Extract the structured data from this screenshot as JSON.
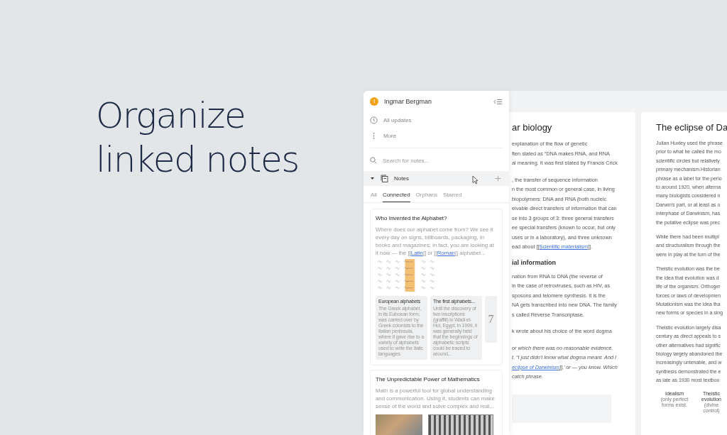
{
  "headline": [
    "Organize",
    "linked notes"
  ],
  "sidebar": {
    "user": {
      "initial": "I",
      "name": "Ingmar Bergman"
    },
    "nav": [
      {
        "kind": "clock",
        "label": "All updates"
      },
      {
        "kind": "dots",
        "label": "More"
      }
    ],
    "search": {
      "placeholder": "Search for notes..."
    },
    "section": {
      "label": "Notes",
      "expanded": true
    },
    "tabs": [
      {
        "label": "All",
        "selected": false
      },
      {
        "label": "Connected",
        "selected": true
      },
      {
        "label": "Orphans",
        "selected": false
      },
      {
        "label": "Starred",
        "selected": false
      }
    ],
    "notes": [
      {
        "kind": "alphabet",
        "title": "Who Invented the Alphabet?",
        "excerpt": [
          {
            "text": "Where does our alphabet come from? We see it every day on signs, billboards, packaging, in books and magazines; in fact, you are looking at it now — the [["
          },
          {
            "link": "Latin"
          },
          {
            "text": "]] or [["
          },
          {
            "link": "Roman"
          },
          {
            "text": "]] alphabet..."
          }
        ],
        "related": [
          {
            "title": "European alphabets",
            "text": "The Greek alphabet, in its Euboean form, was carried over by Greek colonists to the Italian peninsula, where it gave rise to a variety of alphabets used to write the Italic languages."
          },
          {
            "title": "The first alphabets...",
            "text": "Until the discovery of two inscriptions (graffiti) in Wadi el-Hol, Egypt, in 1999, it was generally held that the beginnings of alphabetic scripts could be traced to around..."
          }
        ],
        "more_count": "7"
      },
      {
        "kind": "images",
        "title": "The Unpredictable Power of Mathematics",
        "excerpt": [
          {
            "text": "Math is a powerful tool for global understanding and communication. Using it, students can make sense of the world and solve complex and real..."
          }
        ]
      }
    ]
  },
  "documents": [
    {
      "title": "ar biology",
      "blocks": [
        {
          "kind": "para",
          "lines": [
            [
              {
                "text": "explanation of the flow of genetic"
              }
            ],
            [
              {
                "text": "ften stated as “DNA makes RNA, and RNA"
              }
            ],
            [
              {
                "text": "al meaning. It was first stated by Francis Crick"
              }
            ]
          ]
        },
        {
          "kind": "para",
          "lines": [
            [
              {
                "text": ", the transfer of sequence information"
              }
            ],
            [
              {
                "text": "n the most common or general case, in living"
              }
            ],
            [
              {
                "text": "biopolymers: DNA and RNA (both nucleic"
              }
            ],
            [
              {
                "text": "eivable direct transfers of information that can"
              }
            ],
            [
              {
                "text": "se into 3 groups of 3: three general transfers"
              }
            ],
            [
              {
                "text": "ee special transfers (known to occur, but only"
              }
            ],
            [
              {
                "text": "uses or in a laboratory), and three unknown"
              }
            ],
            [
              {
                "text": "ead about [["
              },
              {
                "link": "Scientific materialism"
              },
              {
                "text": "]]."
              }
            ]
          ]
        },
        {
          "kind": "heading",
          "text": "ial information"
        },
        {
          "kind": "para",
          "lines": [
            [
              {
                "text": "nation from RNA to DNA (the reverse of"
              }
            ],
            [
              {
                "text": "in the case of retroviruses, such as HIV, as"
              }
            ],
            [
              {
                "text": "sposons and telomere synthesis. It is the"
              }
            ],
            [
              {
                "text": "NA gets transcribed into new DNA. The family"
              }
            ],
            [
              {
                "text": "s called Reverse Transcriptase."
              }
            ]
          ]
        },
        {
          "kind": "para",
          "lines": [
            [
              {
                "text": "k wrote about his choice of the word dogma"
              }
            ]
          ]
        },
        {
          "kind": "quote",
          "lines": [
            [
              {
                "text": "or which there was no reasonable evidence."
              }
            ],
            [
              {
                "text": "t. “I just didn't know what dogma meant. And I"
              }
            ],
            [
              {
                "link": "eclipse of Darwinism"
              },
              {
                "text": "]],’ or — you know. Which"
              }
            ],
            [
              {
                "text": "catch phrase."
              }
            ]
          ]
        },
        {
          "kind": "image"
        }
      ]
    },
    {
      "title": "The eclipse of Da",
      "blocks": [
        {
          "kind": "para",
          "lines": [
            [
              {
                "text": "Julian Huxley used the phrase"
              }
            ],
            [
              {
                "text": "prior to what he called the mo"
              }
            ],
            [
              {
                "text": "scientific circles but relatively"
              }
            ],
            [
              {
                "text": "primary mechanism.Historian"
              }
            ],
            [
              {
                "text": "phrase as a label for the perio"
              }
            ],
            [
              {
                "text": "to around 1920, when alterna"
              }
            ],
            [
              {
                "text": "many biologists considered n"
              }
            ],
            [
              {
                "text": "Darwin's part, or at least as o"
              }
            ],
            [
              {
                "text": "interphase of Darwinism, has"
              }
            ],
            [
              {
                "text": "the putative eclipse was prec"
              }
            ]
          ]
        },
        {
          "kind": "para",
          "lines": [
            [
              {
                "text": "While there had been multipl"
              }
            ],
            [
              {
                "text": "and structuralism through the"
              }
            ],
            [
              {
                "text": "were in play at the turn of the"
              }
            ]
          ]
        },
        {
          "kind": "para",
          "lines": [
            [
              {
                "text": "Theistic evolution was the be"
              }
            ],
            [
              {
                "text": "the idea that evolution was d"
              }
            ],
            [
              {
                "text": "life of the organism. Orthoger"
              }
            ],
            [
              {
                "text": "forces or laws of developmen"
              }
            ],
            [
              {
                "text": "Mutationism was the idea tha"
              }
            ],
            [
              {
                "text": "new forms or species in a sing"
              }
            ]
          ]
        },
        {
          "kind": "para",
          "lines": [
            [
              {
                "text": "Theistic evolution largely disa"
              }
            ],
            [
              {
                "text": "century as direct appeals to s"
              }
            ],
            [
              {
                "text": "other alternatives had signific"
              }
            ],
            [
              {
                "text": "biology largely abandoned the"
              }
            ],
            [
              {
                "text": "increasingly untenable, and w"
              }
            ],
            [
              {
                "text": "synthesis demonstrated the e"
              }
            ],
            [
              {
                "text": "as late as 1930 most textboo"
              }
            ]
          ]
        },
        {
          "kind": "diagram",
          "nodes": [
            {
              "label": "Idealism",
              "note": "(only perfect forms exist."
            },
            {
              "label": "Theistic evolution",
              "note": "(divine control)"
            }
          ]
        }
      ]
    }
  ]
}
